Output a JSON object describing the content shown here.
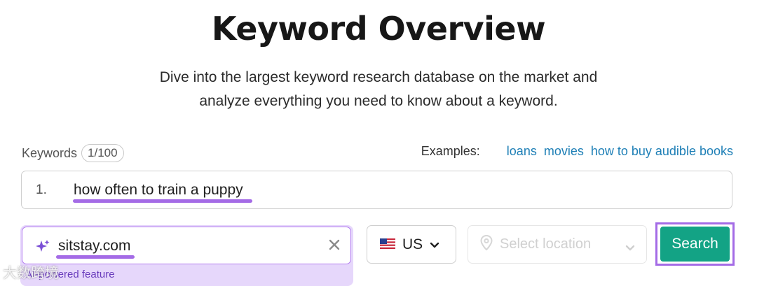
{
  "page": {
    "title": "Keyword Overview",
    "subtitle_line1": "Dive into the largest keyword research database on the market and",
    "subtitle_line2": "analyze everything you need to know about a keyword."
  },
  "keywords": {
    "label": "Keywords",
    "counter": "1/100",
    "examples_label": "Examples:",
    "examples": [
      "loans",
      "movies",
      "how to buy audible books"
    ],
    "rows": [
      {
        "number": "1.",
        "text": "how often to train a puppy"
      }
    ]
  },
  "domain": {
    "value": "sitstay.com",
    "note": "AI-powered feature"
  },
  "country": {
    "selected": "US"
  },
  "location": {
    "placeholder": "Select location"
  },
  "search_button": {
    "label": "Search"
  },
  "watermark": {
    "text": "大数跨境"
  },
  "colors": {
    "accent_purple": "#a46be6",
    "link_blue": "#1e7fb6",
    "search_green": "#13a385"
  }
}
